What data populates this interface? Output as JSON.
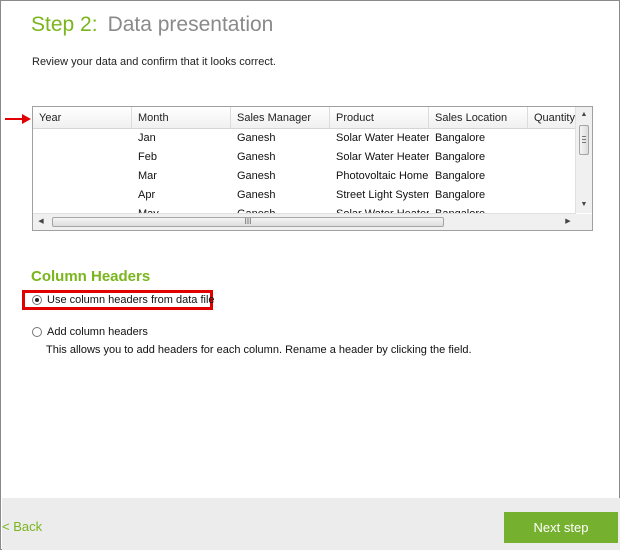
{
  "header": {
    "step": "Step 2:",
    "title": "Data presentation",
    "intro": "Review your data and confirm that it looks correct."
  },
  "grid": {
    "columns": [
      "Year",
      "Month",
      "Sales Manager",
      "Product",
      "Sales Location",
      "Quantity"
    ],
    "rows": [
      [
        "",
        "Jan",
        "Ganesh",
        "Solar Water Heater",
        "Bangalore",
        ""
      ],
      [
        "",
        "Feb",
        "Ganesh",
        "Solar Water Heater",
        "Bangalore",
        ""
      ],
      [
        "",
        "Mar",
        "Ganesh",
        "Photovoltaic Home",
        "Bangalore",
        ""
      ],
      [
        "",
        "Apr",
        "Ganesh",
        "Street Light System",
        "Bangalore",
        ""
      ],
      [
        "",
        "May",
        "Ganesh",
        "Solar Water Heater",
        "Bangalore",
        ""
      ]
    ],
    "scroll_grip": "III"
  },
  "column_headers": {
    "title": "Column Headers",
    "option_use": "Use column headers from data file",
    "option_add": "Add column headers",
    "option_add_desc": "This allows you to add headers for each column. Rename a header by clicking the field.",
    "selected": "use"
  },
  "footer": {
    "back": "< Back",
    "next": "Next step"
  },
  "colors": {
    "accent": "#7ab51d",
    "button": "#75b02e",
    "highlight": "#e00000"
  },
  "icons": {
    "arrow": "red-arrow-icon",
    "scroll_up": "scroll-up-icon",
    "scroll_down": "scroll-down-icon",
    "scroll_left": "scroll-left-icon",
    "scroll_right": "scroll-right-icon"
  }
}
